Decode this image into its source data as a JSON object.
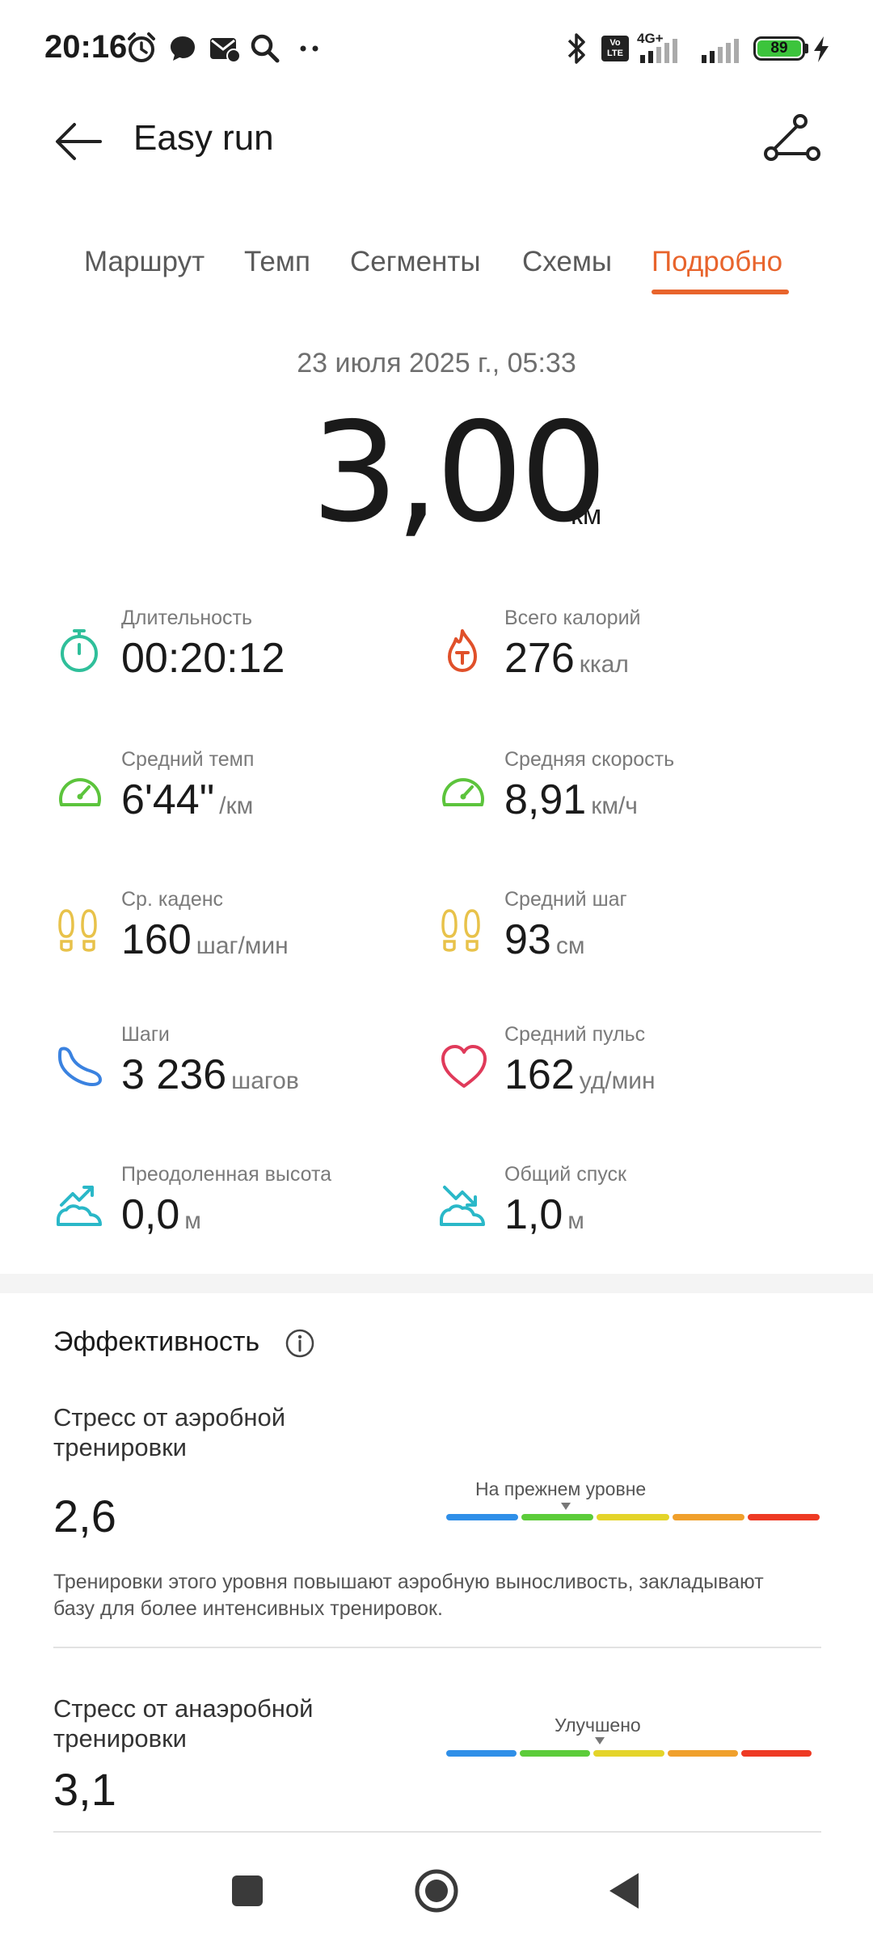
{
  "status_bar": {
    "time": "20:16",
    "battery_level": "89",
    "icons": [
      "alarm-icon",
      "chat-icon",
      "mail-icon",
      "search-icon",
      "more-dots-icon",
      "bluetooth-icon",
      "volte-icon",
      "network-4g-icon",
      "signal-icon",
      "battery-icon",
      "charging-icon"
    ],
    "volte_label": "Vo LTE",
    "network_label": "4G+"
  },
  "header": {
    "title": "Easy run"
  },
  "tabs": [
    {
      "label": "Маршрут",
      "active": false
    },
    {
      "label": "Темп",
      "active": false
    },
    {
      "label": "Сегменты",
      "active": false
    },
    {
      "label": "Схемы",
      "active": false
    },
    {
      "label": "Подробно",
      "active": true
    }
  ],
  "summary": {
    "date": "23 июля 2025 г., 05:33",
    "distance": "3,00",
    "distance_unit": "км"
  },
  "metrics": [
    {
      "label": "Длительность",
      "value": "00:20:12",
      "unit": "",
      "icon": "stopwatch-icon"
    },
    {
      "label": "Всего калорий",
      "value": "276",
      "unit": "ккал",
      "icon": "flame-icon"
    },
    {
      "label": "Средний темп",
      "value": "6'44\"",
      "unit": "/км",
      "icon": "speedometer-icon"
    },
    {
      "label": "Средняя скорость",
      "value": "8,91",
      "unit": "км/ч",
      "icon": "speedometer-icon"
    },
    {
      "label": "Ср. каденс",
      "value": "160",
      "unit": "шаг/мин",
      "icon": "footprints-icon"
    },
    {
      "label": "Средний шаг",
      "value": "93",
      "unit": "см",
      "icon": "footprints-icon"
    },
    {
      "label": "Шаги",
      "value": "3 236",
      "unit": "шагов",
      "icon": "shoe-icon"
    },
    {
      "label": "Средний пульс",
      "value": "162",
      "unit": "уд/мин",
      "icon": "heart-icon"
    },
    {
      "label": "Преодоленная высота",
      "value": "0,0",
      "unit": "м",
      "icon": "ascent-icon"
    },
    {
      "label": "Общий спуск",
      "value": "1,0",
      "unit": "м",
      "icon": "descent-icon"
    }
  ],
  "efficiency": {
    "title": "Эффективность",
    "aerobic": {
      "title": "Стресс от аэробной тренировки",
      "value": "2,6",
      "scale_label": "На прежнем уровне",
      "marker_position": 0.32,
      "description": "Тренировки этого уровня повышают аэробную выносливость, закладывают базу для более интенсивных тренировок."
    },
    "anaerobic": {
      "title": "Стресс от анаэробной тренировки",
      "value": "3,1",
      "scale_label": "Улучшено",
      "marker_position": 0.42
    },
    "scale_colors": [
      "#2f8fe8",
      "#5ccc3a",
      "#e4d42a",
      "#f0a02c",
      "#ee3a24"
    ]
  },
  "colors": {
    "accent": "#e8642c",
    "stopwatch": "#2fbf9a",
    "flame": "#e0502a",
    "speedometer": "#5cc43c",
    "footprints": "#e8c24a",
    "shoe": "#3a82e0",
    "heart": "#e03a5a",
    "altitude": "#2ab8c8"
  }
}
